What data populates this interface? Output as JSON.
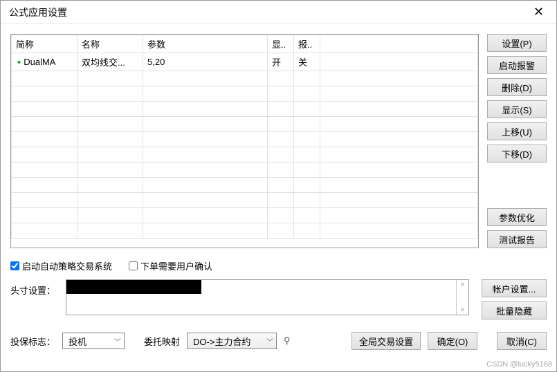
{
  "window": {
    "title": "公式应用设置"
  },
  "table": {
    "headers": {
      "abbr": "简称",
      "name": "名称",
      "param": "参数",
      "display": "显..",
      "alarm": "报.."
    },
    "rows": [
      {
        "abbr": "DualMA",
        "name": "双均线交...",
        "param": "5,20",
        "display": "开",
        "alarm": "关"
      }
    ]
  },
  "sideButtons": {
    "settings": "设置(P)",
    "startAlarm": "启动报警",
    "delete": "删除(D)",
    "show": "显示(S)",
    "moveUp": "上移(U)",
    "moveDown": "下移(D)",
    "paramOpt": "参数优化",
    "testReport": "测试报告"
  },
  "checks": {
    "autoStrategy": "启动自动策略交易系统",
    "confirmOrder": "下单需要用户确认"
  },
  "position": {
    "label": "头寸设置：",
    "accountSettings": "帐户设置...",
    "batchHide": "批量隐藏"
  },
  "bottom": {
    "flagLabel": "投保标志：",
    "flagValue": "投机",
    "mapLabel": "委托映射",
    "mapValue": "DO->主力合约",
    "globalSettings": "全局交易设置",
    "ok": "确定(O)",
    "cancel": "取消(C)"
  },
  "footer": "CSDN @lucky5168"
}
